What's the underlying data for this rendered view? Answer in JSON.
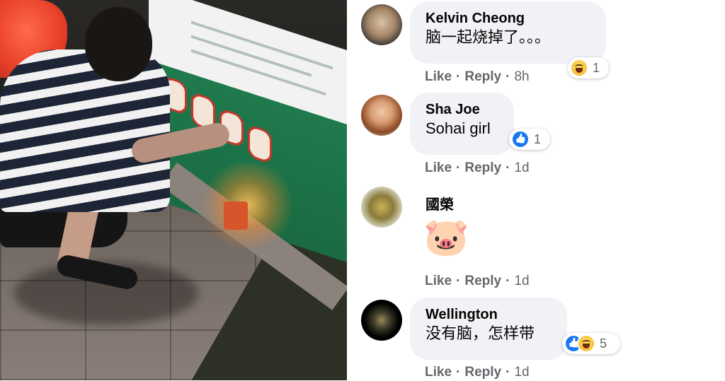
{
  "comments": [
    {
      "author": "Kelvin Cheong",
      "text": "脑一起烧掉了。。。",
      "reactions": {
        "icons": [
          "haha-icon"
        ],
        "count": "1"
      },
      "actions": {
        "like": "Like",
        "reply": "Reply",
        "time": "8h"
      }
    },
    {
      "author": "Sha Joe",
      "text": "Sohai girl",
      "reactions": {
        "icons": [
          "like-icon"
        ],
        "count": "1"
      },
      "actions": {
        "like": "Like",
        "reply": "Reply",
        "time": "1d"
      }
    },
    {
      "author": "國榮",
      "text": "",
      "emoji": "🐷",
      "actions": {
        "like": "Like",
        "reply": "Reply",
        "time": "1d"
      }
    },
    {
      "author": "Wellington",
      "text": "没有脑，怎样带",
      "reactions": {
        "icons": [
          "like-icon",
          "haha-icon"
        ],
        "count": "5"
      },
      "actions": {
        "like": "Like",
        "reply": "Reply",
        "time": "1d"
      }
    }
  ],
  "colors": {
    "bubble": "#f0f2f5",
    "meta": "#65676b",
    "like": "#1877f2",
    "haha": "#f7b125"
  }
}
